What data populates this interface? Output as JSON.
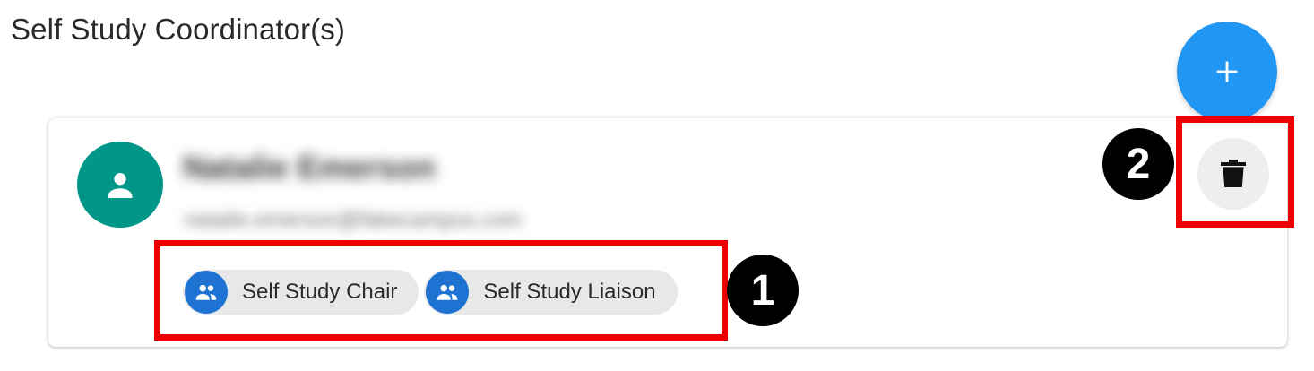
{
  "section": {
    "title": "Self Study Coordinator(s)"
  },
  "add_button": {
    "icon": "plus-icon"
  },
  "coordinator_card": {
    "name": "Natalie Emerson",
    "email": "natalie.emerson@fakecampus.com",
    "avatar_icon": "person-icon",
    "avatar_color": "#009688",
    "roles": [
      {
        "label": "Self Study Chair",
        "icon": "group-icon"
      },
      {
        "label": "Self Study Liaison",
        "icon": "group-icon"
      }
    ],
    "delete_icon": "trash-icon"
  },
  "annotations": {
    "marker_1": "1",
    "marker_2": "2",
    "highlight_color": "#ee0000"
  },
  "colors": {
    "fab": "#2196f3",
    "chip_icon": "#1e73d2",
    "chip_bg": "#e8e8e8"
  }
}
